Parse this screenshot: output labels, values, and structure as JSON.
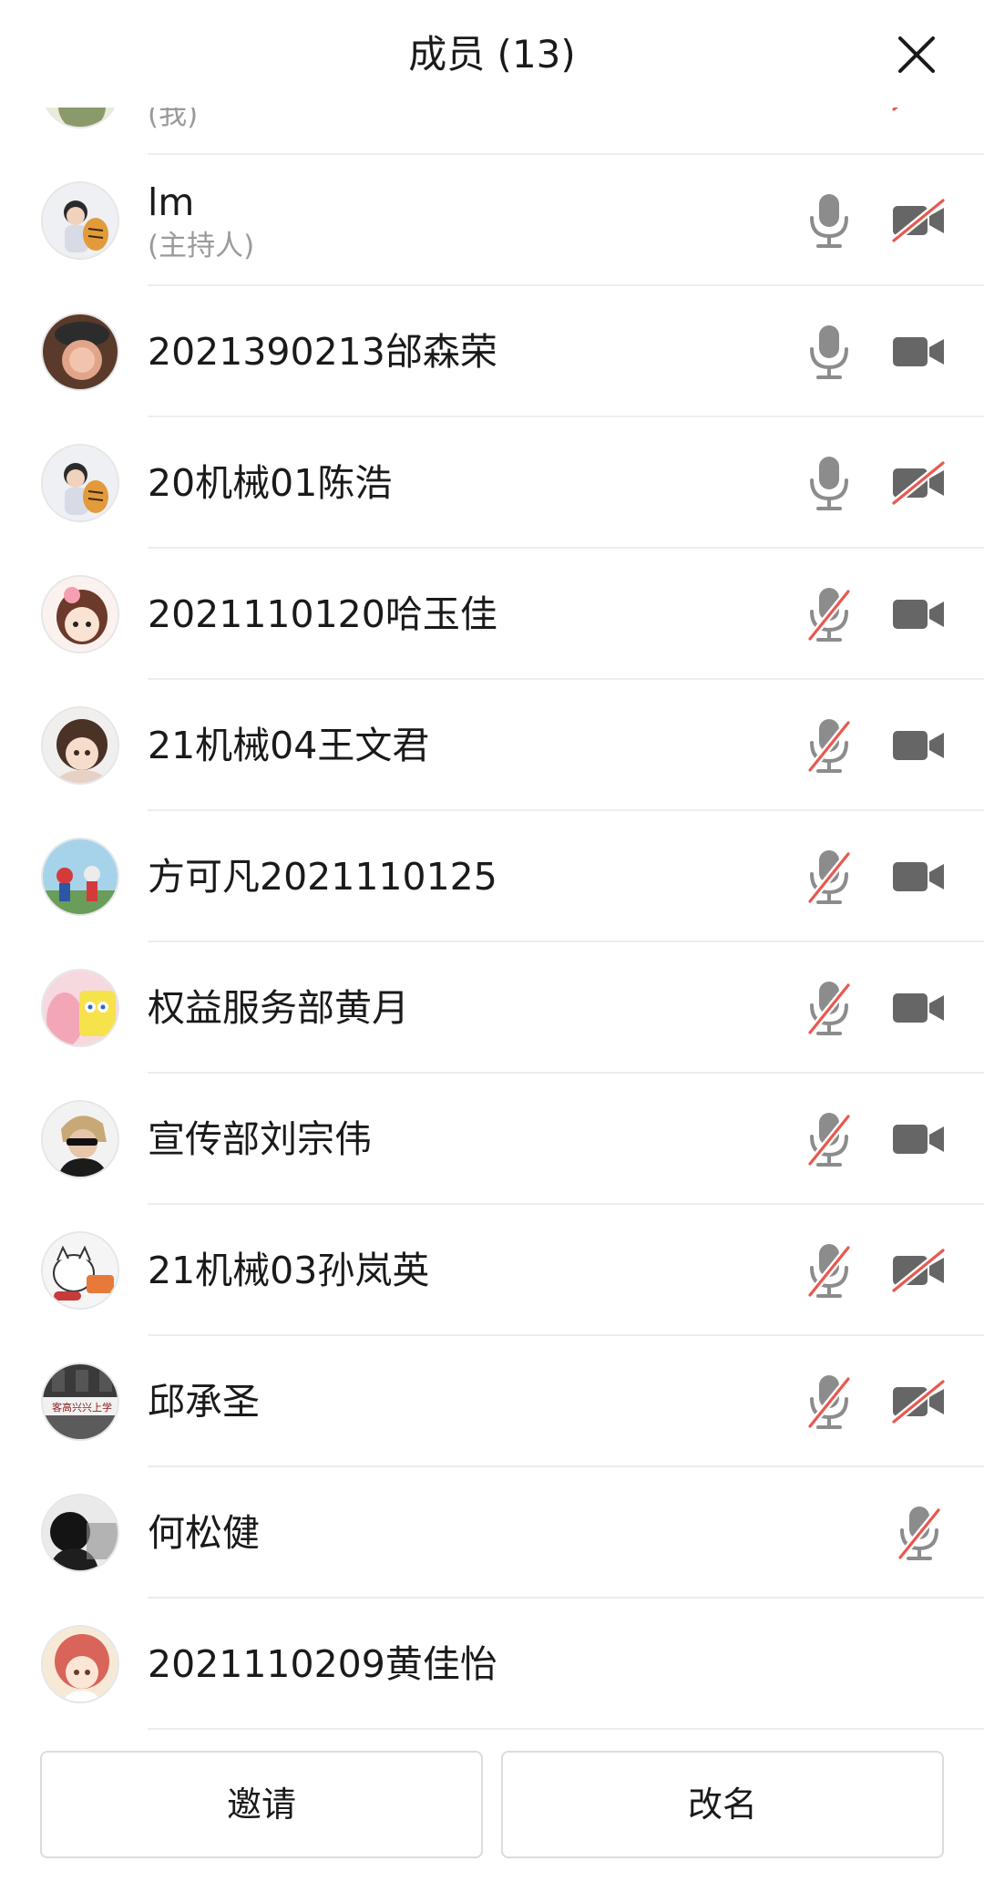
{
  "header": {
    "title": "成员 (13)"
  },
  "colors": {
    "icon_gray": "#8c8c8c",
    "icon_dark": "#666666",
    "muted_red": "#e8584f",
    "divider": "#ededed",
    "subtext": "#9a9a9a"
  },
  "members": [
    {
      "name": "",
      "sub": "(我)",
      "mic": "none",
      "cam": "off",
      "avatar": "avatar-self"
    },
    {
      "name": "lm",
      "sub": "(主持人)",
      "mic": "on",
      "cam": "off",
      "avatar": "avatar-boy-with-tiger"
    },
    {
      "name": "2021390213邰森荣",
      "sub": "",
      "mic": "on",
      "cam": "on",
      "avatar": "avatar-blurred-face"
    },
    {
      "name": "20机械01陈浩",
      "sub": "",
      "mic": "on",
      "cam": "off",
      "avatar": "avatar-boy-with-tiger"
    },
    {
      "name": "2021110120哈玉佳",
      "sub": "",
      "mic": "off",
      "cam": "on",
      "avatar": "avatar-cartoon-girl"
    },
    {
      "name": "21机械04王文君",
      "sub": "",
      "mic": "off",
      "cam": "on",
      "avatar": "avatar-anime-girl"
    },
    {
      "name": "方可凡2021110125",
      "sub": "",
      "mic": "off",
      "cam": "on",
      "avatar": "avatar-game-characters"
    },
    {
      "name": "权益服务部黄月",
      "sub": "",
      "mic": "off",
      "cam": "on",
      "avatar": "avatar-spongebob-patrick"
    },
    {
      "name": "宣传部刘宗伟",
      "sub": "",
      "mic": "off",
      "cam": "on",
      "avatar": "avatar-sunglasses-man"
    },
    {
      "name": "21机械03孙岚英",
      "sub": "",
      "mic": "off",
      "cam": "off",
      "avatar": "avatar-cartoon-cat"
    },
    {
      "name": "邱承圣",
      "sub": "",
      "mic": "off",
      "cam": "off",
      "avatar": "avatar-building",
      "avatar_text": "客高兴兴上学"
    },
    {
      "name": "何松健",
      "sub": "",
      "mic": "off",
      "cam": "none",
      "avatar": "avatar-dark-photo"
    },
    {
      "name": "2021110209黄佳怡",
      "sub": "",
      "mic": "none",
      "cam": "none",
      "avatar": "avatar-anime-redhair"
    }
  ],
  "footer": {
    "invite_label": "邀请",
    "rename_label": "改名"
  }
}
